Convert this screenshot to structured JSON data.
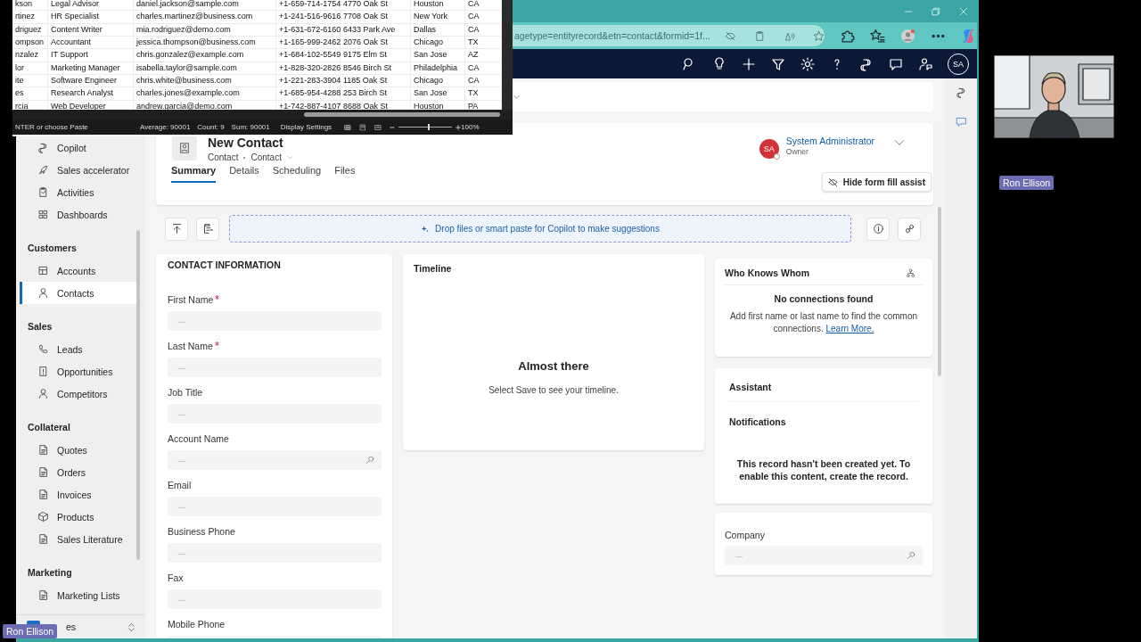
{
  "spreadsheet": {
    "rows": [
      [
        "kson",
        "Legal Advisor",
        "daniel.jackson@sample.com",
        "+1-659-714-1754",
        "4770 Oak St",
        "Houston",
        "CA"
      ],
      [
        "rtinez",
        "HR Specialist",
        "charles.martinez@business.com",
        "+1-241-516-9616",
        "7708 Oak St",
        "New York",
        "CA"
      ],
      [
        "driguez",
        "Content Writer",
        "mia.rodriguez@demo.com",
        "+1-631-672-6160",
        "6433 Park Ave",
        "Dallas",
        "CA"
      ],
      [
        "ompson",
        "Accountant",
        "jessica.thompson@business.com",
        "+1-165-999-2462",
        "2076 Oak St",
        "Chicago",
        "TX"
      ],
      [
        "nzalez",
        "IT Support",
        "chris.gonzalez@example.com",
        "+1-684-102-5549",
        "9175 Elm St",
        "San Jose",
        "AZ"
      ],
      [
        "lor",
        "Marketing Manager",
        "isabella.taylor@sample.com",
        "+1-828-320-2826",
        "8546 Birch St",
        "Philadelphia",
        "CA"
      ],
      [
        "ite",
        "Software Engineer",
        "chris.white@business.com",
        "+1-221-283-3904",
        "1185 Oak St",
        "Chicago",
        "CA"
      ],
      [
        "es",
        "Research Analyst",
        "charles.jones@example.com",
        "+1-685-954-4288",
        "253 Birch St",
        "San Jose",
        "TX"
      ],
      [
        "rcia",
        "Web Developer",
        "andrew.garcia@demo.com",
        "+1-742-887-4107",
        "8688 Oak St",
        "Houston",
        "PA"
      ]
    ],
    "status_bar": {
      "message": "NTER or choose Paste",
      "average": "Average: 90001",
      "count": "Count: 9",
      "sum": "Sum: 90001",
      "display_settings": "Display Settings",
      "zoom": "100%",
      "zoom_slider": {
        "level": 0.55
      }
    }
  },
  "browser": {
    "url": "agetype=entityrecord&etn=contact&formid=1f..."
  },
  "nav_bar": {
    "avatar": "SA"
  },
  "sidebar": {
    "items": [
      {
        "label": "Copilot",
        "selected": false
      },
      {
        "label": "Sales accelerator",
        "selected": false
      },
      {
        "label": "Activities",
        "selected": false
      },
      {
        "label": "Dashboards",
        "selected": false
      }
    ],
    "groups": [
      {
        "title": "Customers",
        "items": [
          {
            "label": "Accounts",
            "selected": false
          },
          {
            "label": "Contacts",
            "selected": true
          }
        ]
      },
      {
        "title": "Sales",
        "items": [
          {
            "label": "Leads",
            "selected": false
          },
          {
            "label": "Opportunities",
            "selected": false
          },
          {
            "label": "Competitors",
            "selected": false
          }
        ]
      },
      {
        "title": "Collateral",
        "items": [
          {
            "label": "Quotes",
            "selected": false
          },
          {
            "label": "Orders",
            "selected": false
          },
          {
            "label": "Invoices",
            "selected": false
          },
          {
            "label": "Products",
            "selected": false
          },
          {
            "label": "Sales Literature",
            "selected": false
          }
        ]
      },
      {
        "title": "Marketing",
        "items": [
          {
            "label": "Marketing Lists",
            "selected": false
          }
        ]
      }
    ],
    "area_switcher": {
      "label": "es"
    }
  },
  "header": {
    "title": "New Contact",
    "entity": "Contact",
    "form": "Contact",
    "owner": {
      "initials": "SA",
      "name": "System Administrator",
      "role": "Owner"
    },
    "tabs": [
      {
        "label": "Summary",
        "selected": true
      },
      {
        "label": "Details",
        "selected": false
      },
      {
        "label": "Scheduling",
        "selected": false
      },
      {
        "label": "Files",
        "selected": false
      }
    ],
    "assist_button": "Hide form fill assist"
  },
  "drop_zone": "Drop files or smart paste for Copilot to make suggestions",
  "contact_section": {
    "title": "CONTACT INFORMATION",
    "fields": [
      {
        "label": "First Name",
        "required": true,
        "kind": "text",
        "placeholder": "---"
      },
      {
        "label": "Last Name",
        "required": true,
        "kind": "text",
        "placeholder": "---"
      },
      {
        "label": "Job Title",
        "required": false,
        "kind": "text",
        "placeholder": "---"
      },
      {
        "label": "Account Name",
        "required": false,
        "kind": "lookup",
        "placeholder": "---"
      },
      {
        "label": "Email",
        "required": false,
        "kind": "text",
        "placeholder": "---"
      },
      {
        "label": "Business Phone",
        "required": false,
        "kind": "text",
        "placeholder": "---"
      },
      {
        "label": "Fax",
        "required": false,
        "kind": "text",
        "placeholder": "---"
      },
      {
        "label": "Mobile Phone",
        "required": false,
        "kind": "text"
      }
    ]
  },
  "timeline": {
    "title": "Timeline",
    "heading": "Almost there",
    "message": "Select Save to see your timeline."
  },
  "who_knows_whom": {
    "title": "Who Knows Whom",
    "heading": "No connections found",
    "message": "Add first name or last name to find the common connections.",
    "link": "Learn More."
  },
  "assistant": {
    "title": "Assistant",
    "subtitle": "Notifications",
    "message": "This record hasn't been created yet. To enable this content, create the record."
  },
  "company": {
    "label": "Company",
    "placeholder": "---"
  },
  "meeting": {
    "camera_name": "Ron Ellison",
    "presenter_name": "Ron Ellison"
  }
}
